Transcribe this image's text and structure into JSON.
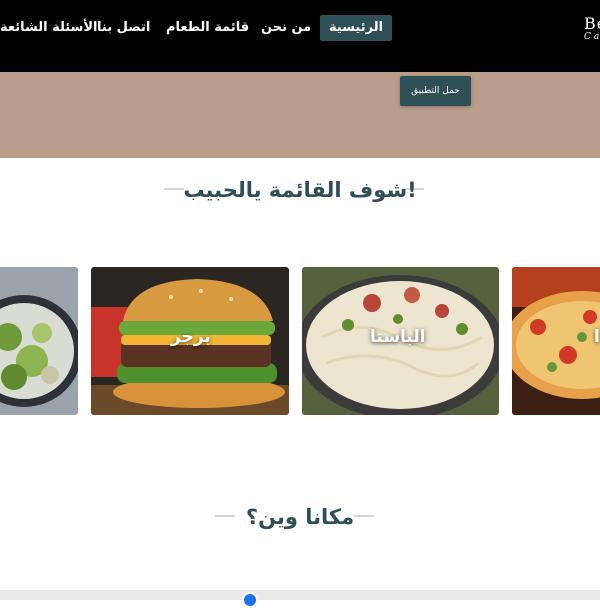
{
  "nav": {
    "brand": "Be",
    "brand_sub": "Ca",
    "items": [
      "الرئيسية",
      "من نحن",
      "قائمة الطعام",
      "اتصل بنا",
      "الأسئلة الشائعة"
    ]
  },
  "hero": {
    "app_button": "حمل التطبيق"
  },
  "menu_section": {
    "title": "شوف القائمة يالحبيب!",
    "cards": [
      {
        "label": ""
      },
      {
        "label": "برجر"
      },
      {
        "label": "الباستا"
      },
      {
        "label": "ا"
      }
    ]
  },
  "location_section": {
    "title": "مكانا وين؟"
  },
  "colors": {
    "nav_background": "#000000",
    "accent": "#2f4f56",
    "hero_background": "#b99d8b"
  }
}
